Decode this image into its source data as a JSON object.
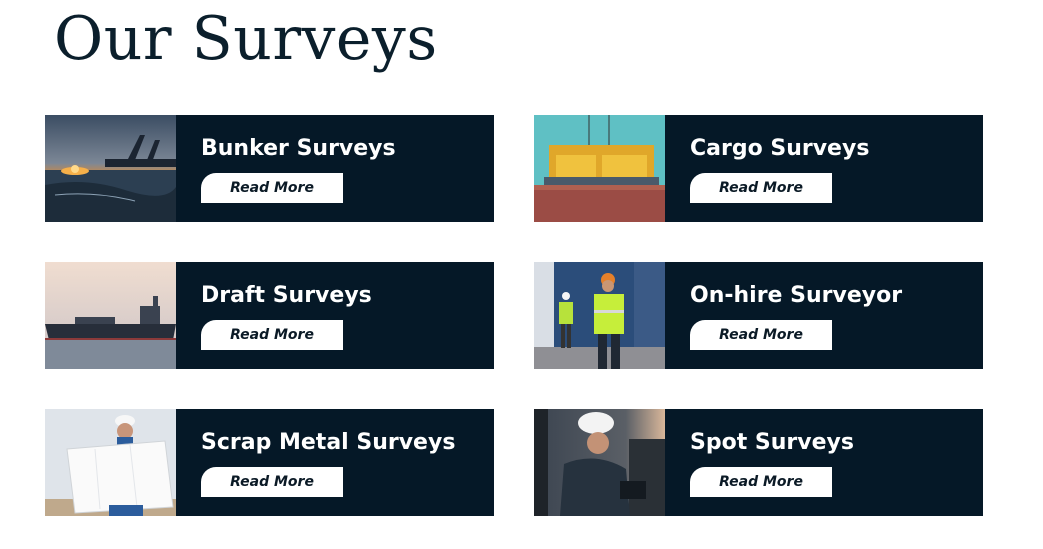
{
  "page": {
    "title": "Our Surveys"
  },
  "surveys": [
    {
      "title": "Bunker Surveys",
      "button": "Read More",
      "image": "port-sunset-photo"
    },
    {
      "title": "Cargo Surveys",
      "button": "Read More",
      "image": "cargo-crane-photo"
    },
    {
      "title": "Draft Surveys",
      "button": "Read More",
      "image": "tanker-ship-photo"
    },
    {
      "title": "On-hire Surveyor",
      "button": "Read More",
      "image": "workers-hi-vis-photo"
    },
    {
      "title": "Scrap Metal Surveys",
      "button": "Read More",
      "image": "engineer-blueprint-photo"
    },
    {
      "title": "Spot Surveys",
      "button": "Read More",
      "image": "inspector-tablet-photo"
    }
  ],
  "colors": {
    "card_bg": "#051827",
    "title": "#0b1f2c",
    "button_bg": "#ffffff"
  }
}
